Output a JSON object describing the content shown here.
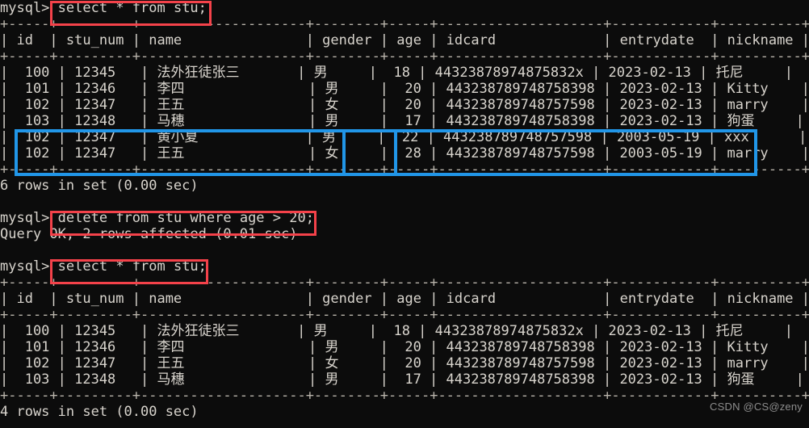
{
  "terminal": {
    "prompt": "mysql>",
    "theme": {
      "background": "#0c0c0c",
      "foreground": "#d8d4cd",
      "rule_color": "#b9b4ab",
      "highlight_red": "#f4424a",
      "highlight_blue": "#2196e8",
      "watermark_color": "#8d8d8d"
    }
  },
  "watermark": {
    "text": "CSDN @CS@zeny"
  },
  "commands": {
    "select_1": "select * from stu;",
    "delete_1": "delete from stu where age > 20;",
    "select_2": "select * from stu;"
  },
  "results": {
    "rows_6": "6 rows in set (0.00 sec)",
    "query_ok": "Query OK, 2 rows affected (0.01 sec)",
    "rows_4": "4 rows in set (0.00 sec)"
  },
  "table": {
    "rule": "+-----+---------+--------------------+--------+-----+--------------------+------------+----------+",
    "columns": [
      {
        "name": "id",
        "width": 5,
        "align": "right"
      },
      {
        "name": "stu_num",
        "width": 9,
        "align": "left"
      },
      {
        "name": "name",
        "width": 20,
        "align": "left"
      },
      {
        "name": "gender",
        "width": 8,
        "align": "left"
      },
      {
        "name": "age",
        "width": 5,
        "align": "right"
      },
      {
        "name": "idcard",
        "width": 20,
        "align": "left"
      },
      {
        "name": "entrydate",
        "width": 12,
        "align": "left"
      },
      {
        "name": "nickname",
        "width": 10,
        "align": "left"
      }
    ],
    "header_line": "| id  | stu_num | name               | gender | age | idcard             | entrydate  | nickname |"
  },
  "table_before": {
    "rows": [
      {
        "id": "100",
        "stu_num": "12345",
        "name": "法外狂徒张三",
        "gender": "男",
        "age": "18",
        "idcard": "44323878974875832x",
        "entrydate": "2023-02-13",
        "nickname": "托尼"
      },
      {
        "id": "101",
        "stu_num": "12346",
        "name": "李四",
        "gender": "男",
        "age": "20",
        "idcard": "44323878974875​8398",
        "entrydate": "2023-02-13",
        "nickname": "Kitty"
      },
      {
        "id": "102",
        "stu_num": "12347",
        "name": "王五",
        "gender": "女",
        "age": "20",
        "idcard": "44323878974875​7598",
        "entrydate": "2023-02-13",
        "nickname": "marry"
      },
      {
        "id": "103",
        "stu_num": "12348",
        "name": "马穗",
        "gender": "男",
        "age": "17",
        "idcard": "44323878974875​8398",
        "entrydate": "2023-02-13",
        "nickname": "狗蛋"
      },
      {
        "id": "102",
        "stu_num": "12347",
        "name": "黄小夏",
        "gender": "男",
        "age": "22",
        "idcard": "44323878974875​7598",
        "entrydate": "2003-05-19",
        "nickname": "xxx"
      },
      {
        "id": "102",
        "stu_num": "12347",
        "name": "王五",
        "gender": "女",
        "age": "28",
        "idcard": "44323878974875​7598",
        "entrydate": "2003-05-19",
        "nickname": "marry"
      }
    ],
    "rendered": [
      "|  100 | 12345   | 法外狂徒张三       | 男     |  18 | 44323878974875832x | 2023-02-13 | 托尼     |",
      "|  101 | 12346   | 李四               | 男     |  20 | 44323878974875​8398 | 2023-02-13 | Kitty    |",
      "|  102 | 12347   | 王五               | 女     |  20 | 44323878974875​7598 | 2023-02-13 | marry    |",
      "|  103 | 12348   | 马穗               | 男     |  17 | 44323878974875​8398 | 2023-02-13 | 狗蛋     |",
      "|  102 | 12347   | 黄小夏             | 男     |  22 | 44323878974875​7598 | 2003-05-19 | xxx      |",
      "|  102 | 12347   | 王五               | 女     |  28 | 44323878974875​7598 | 2003-05-19 | marry    |"
    ]
  },
  "table_after": {
    "rows": [
      {
        "id": "100",
        "stu_num": "12345",
        "name": "法外狂徒张三",
        "gender": "男",
        "age": "18",
        "idcard": "44323878974875832x",
        "entrydate": "2023-02-13",
        "nickname": "托尼"
      },
      {
        "id": "101",
        "stu_num": "12346",
        "name": "李四",
        "gender": "男",
        "age": "20",
        "idcard": "44323878974875​8398",
        "entrydate": "2023-02-13",
        "nickname": "Kitty"
      },
      {
        "id": "102",
        "stu_num": "12347",
        "name": "王五",
        "gender": "女",
        "age": "20",
        "idcard": "44323878974875​7598",
        "entrydate": "2023-02-13",
        "nickname": "marry"
      },
      {
        "id": "103",
        "stu_num": "12348",
        "name": "马穗",
        "gender": "男",
        "age": "17",
        "idcard": "44323878974875​8398",
        "entrydate": "2023-02-13",
        "nickname": "狗蛋"
      }
    ]
  },
  "annotations": {
    "red_boxes": [
      {
        "label": "select * from stu;",
        "target": "select_1"
      },
      {
        "label": "delete from stu where age > 20;",
        "target": "delete_1"
      },
      {
        "label": "select * from stu;",
        "target": "select_2"
      }
    ],
    "blue_boxes": [
      {
        "label": "deleted-rows-highlight"
      },
      {
        "label": "age-column-highlight"
      }
    ]
  }
}
